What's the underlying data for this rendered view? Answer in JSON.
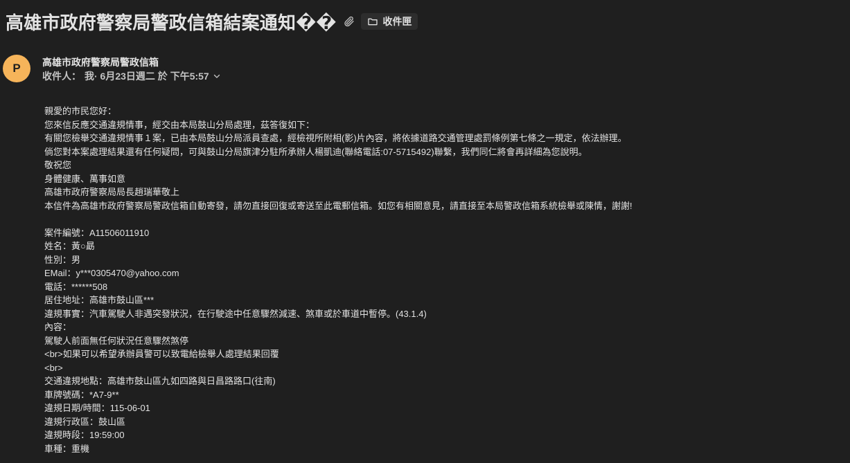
{
  "subject": "高雄市政府警察局警政信箱結案通知��",
  "label": "收件匣",
  "icons": {
    "attachment": "paperclip-icon",
    "label": "folder-icon",
    "details": "chevron-down-icon"
  },
  "colors": {
    "background": "#1f1f1f",
    "avatar": "#f6b45a",
    "text": "#e3e3e3"
  },
  "sender": {
    "avatar_letter": "P",
    "name": "高雄市政府警察局警政信箱",
    "recipient_label": "收件人：",
    "recipient": "我",
    "date": "· 6月23日週二 於 下午5:57"
  },
  "body_lines": [
    "親愛的市民您好：",
    "您來信反應交通違規情事，經交由本局鼓山分局處理，茲答復如下：",
    "有關您檢舉交通違規情事１案，已由本局鼓山分局派員查處，經檢視所附相(影)片內容，將依據道路交通管理處罰條例第七條之一規定，依法辦理。",
    "倘您對本案處理結果還有任何疑問，可與鼓山分局旗津分駐所承辦人楊凱迪(聯絡電話:07-5715492)聯繫，我們同仁將會再詳細為您說明。",
    "敬祝您",
    "身體健康、萬事如意",
    "高雄市政府警察局局長趙瑞華敬上",
    "本信件為高雄市政府警察局警政信箱自動寄發，請勿直接回復或寄送至此電郵信箱。如您有相關意見，請直接至本局警政信箱系統檢舉或陳情，謝謝!",
    "",
    "案件編號：A11506011910",
    "姓名：黃○勗",
    "性別：男",
    "EMail：y***0305470@yahoo.com",
    "電話：******508",
    "居住地址：高雄市鼓山區***",
    "違規事實：汽車駕駛人非遇突發狀況，在行駛途中任意驟然減速、煞車或於車道中暫停。(43.1.4)",
    "內容：",
    "駕駛人前面無任何狀況任意驟然煞停",
    "<br>如果可以希望承辦員警可以致電給檢舉人處理結果回覆",
    "<br>",
    "交通違規地點：高雄市鼓山區九如四路與日昌路路口(往南)",
    "車牌號碼：*A7-9**",
    "違規日期/時間：115-06-01",
    "違規行政區：鼓山區",
    "違規時段：19:59:00",
    "車種：重機"
  ]
}
